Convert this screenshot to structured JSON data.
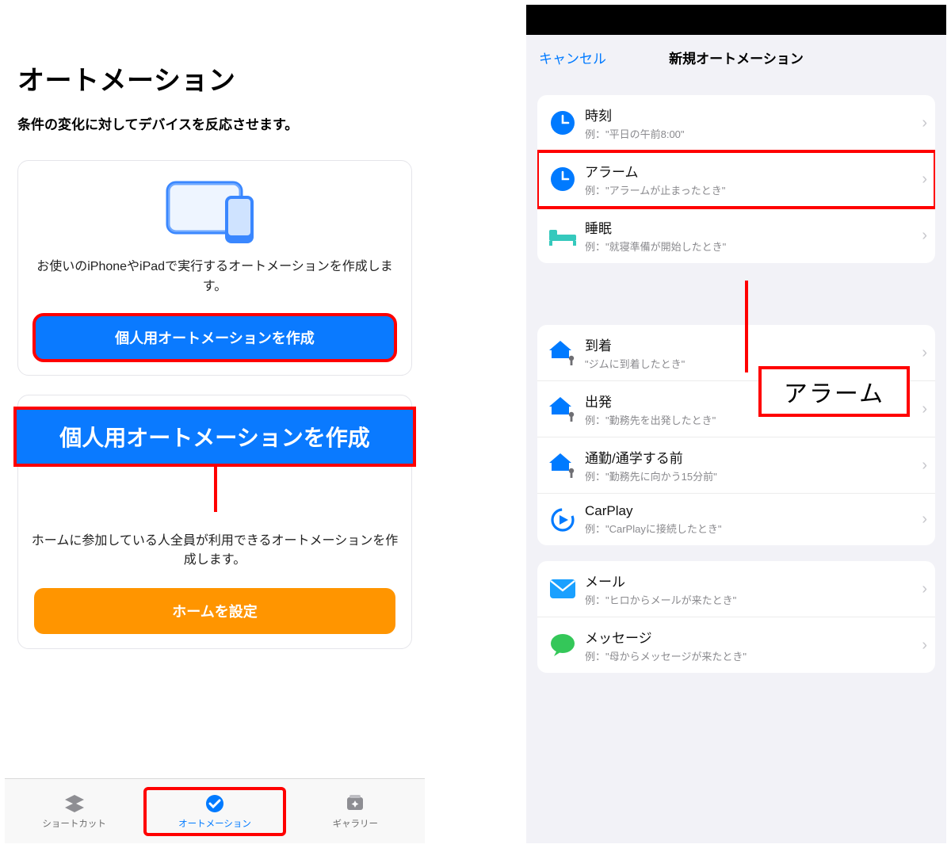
{
  "left": {
    "title": "オートメーション",
    "subtitle": "条件の変化に対してデバイスを反応させます。",
    "card1_text": "お使いのiPhoneやiPadで実行するオートメーションを作成します。",
    "button_personal": "個人用オートメーションを作成",
    "callout_personal": "個人用オートメーションを作成",
    "card2_text": "ホームに参加している人全員が利用できるオートメーションを作成します。",
    "button_home": "ホームを設定",
    "tabs": {
      "shortcuts": "ショートカット",
      "automation": "オートメーション",
      "gallery": "ギャラリー"
    }
  },
  "right": {
    "cancel": "キャンセル",
    "title": "新規オートメーション",
    "callout_alarm": "アラーム",
    "group1": [
      {
        "title": "時刻",
        "sub": "例：\"平日の午前8:00\""
      },
      {
        "title": "アラーム",
        "sub": "例：\"アラームが止まったとき\""
      },
      {
        "title": "睡眠",
        "sub": "例：\"就寝準備が開始したとき\""
      }
    ],
    "group2": [
      {
        "title": "到着",
        "sub": "\"ジムに到着したとき\""
      },
      {
        "title": "出発",
        "sub": "例：\"勤務先を出発したとき\""
      },
      {
        "title": "通勤/通学する前",
        "sub": "例：\"勤務先に向かう15分前\""
      },
      {
        "title": "CarPlay",
        "sub": "例：\"CarPlayに接続したとき\""
      }
    ],
    "group3": [
      {
        "title": "メール",
        "sub": "例：\"ヒロからメールが来たとき\""
      },
      {
        "title": "メッセージ",
        "sub": "例：\"母からメッセージが来たとき\""
      }
    ]
  }
}
